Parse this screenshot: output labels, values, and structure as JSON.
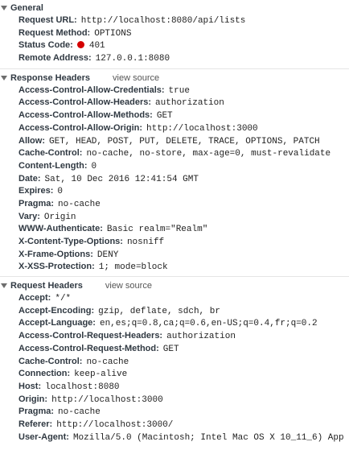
{
  "general": {
    "title": "General",
    "rows": [
      {
        "key": "Request URL:",
        "value": "http://localhost:8080/api/lists"
      },
      {
        "key": "Request Method:",
        "value": "OPTIONS"
      },
      {
        "key": "Status Code:",
        "value": "401",
        "status_color": "#d40000"
      },
      {
        "key": "Remote Address:",
        "value": "127.0.0.1:8080"
      }
    ]
  },
  "response_headers": {
    "title": "Response Headers",
    "view_source": "view source",
    "rows": [
      {
        "key": "Access-Control-Allow-Credentials:",
        "value": "true"
      },
      {
        "key": "Access-Control-Allow-Headers:",
        "value": "authorization"
      },
      {
        "key": "Access-Control-Allow-Methods:",
        "value": "GET"
      },
      {
        "key": "Access-Control-Allow-Origin:",
        "value": "http://localhost:3000"
      },
      {
        "key": "Allow:",
        "value": "GET, HEAD, POST, PUT, DELETE, TRACE, OPTIONS, PATCH"
      },
      {
        "key": "Cache-Control:",
        "value": "no-cache, no-store, max-age=0, must-revalidate"
      },
      {
        "key": "Content-Length:",
        "value": "0"
      },
      {
        "key": "Date:",
        "value": "Sat, 10 Dec 2016 12:41:54 GMT"
      },
      {
        "key": "Expires:",
        "value": "0"
      },
      {
        "key": "Pragma:",
        "value": "no-cache"
      },
      {
        "key": "Vary:",
        "value": "Origin"
      },
      {
        "key": "WWW-Authenticate:",
        "value": "Basic realm=\"Realm\""
      },
      {
        "key": "X-Content-Type-Options:",
        "value": "nosniff"
      },
      {
        "key": "X-Frame-Options:",
        "value": "DENY"
      },
      {
        "key": "X-XSS-Protection:",
        "value": "1; mode=block"
      }
    ]
  },
  "request_headers": {
    "title": "Request Headers",
    "view_source": "view source",
    "rows": [
      {
        "key": "Accept:",
        "value": "*/*"
      },
      {
        "key": "Accept-Encoding:",
        "value": "gzip, deflate, sdch, br"
      },
      {
        "key": "Accept-Language:",
        "value": "en,es;q=0.8,ca;q=0.6,en-US;q=0.4,fr;q=0.2"
      },
      {
        "key": "Access-Control-Request-Headers:",
        "value": "authorization"
      },
      {
        "key": "Access-Control-Request-Method:",
        "value": "GET"
      },
      {
        "key": "Cache-Control:",
        "value": "no-cache"
      },
      {
        "key": "Connection:",
        "value": "keep-alive"
      },
      {
        "key": "Host:",
        "value": "localhost:8080"
      },
      {
        "key": "Origin:",
        "value": "http://localhost:3000"
      },
      {
        "key": "Pragma:",
        "value": "no-cache"
      },
      {
        "key": "Referer:",
        "value": "http://localhost:3000/"
      },
      {
        "key": "User-Agent:",
        "value": "Mozilla/5.0 (Macintosh; Intel Mac OS X 10_11_6) App"
      }
    ]
  }
}
